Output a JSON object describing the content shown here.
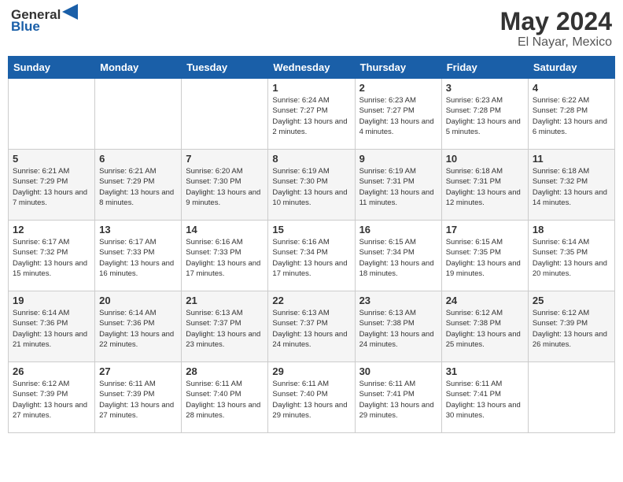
{
  "header": {
    "logo_general": "General",
    "logo_blue": "Blue",
    "title": "May 2024",
    "subtitle": "El Nayar, Mexico"
  },
  "days_of_week": [
    "Sunday",
    "Monday",
    "Tuesday",
    "Wednesday",
    "Thursday",
    "Friday",
    "Saturday"
  ],
  "weeks": [
    [
      {
        "day": "",
        "info": ""
      },
      {
        "day": "",
        "info": ""
      },
      {
        "day": "",
        "info": ""
      },
      {
        "day": "1",
        "info": "Sunrise: 6:24 AM\nSunset: 7:27 PM\nDaylight: 13 hours and 2 minutes."
      },
      {
        "day": "2",
        "info": "Sunrise: 6:23 AM\nSunset: 7:27 PM\nDaylight: 13 hours and 4 minutes."
      },
      {
        "day": "3",
        "info": "Sunrise: 6:23 AM\nSunset: 7:28 PM\nDaylight: 13 hours and 5 minutes."
      },
      {
        "day": "4",
        "info": "Sunrise: 6:22 AM\nSunset: 7:28 PM\nDaylight: 13 hours and 6 minutes."
      }
    ],
    [
      {
        "day": "5",
        "info": "Sunrise: 6:21 AM\nSunset: 7:29 PM\nDaylight: 13 hours and 7 minutes."
      },
      {
        "day": "6",
        "info": "Sunrise: 6:21 AM\nSunset: 7:29 PM\nDaylight: 13 hours and 8 minutes."
      },
      {
        "day": "7",
        "info": "Sunrise: 6:20 AM\nSunset: 7:30 PM\nDaylight: 13 hours and 9 minutes."
      },
      {
        "day": "8",
        "info": "Sunrise: 6:19 AM\nSunset: 7:30 PM\nDaylight: 13 hours and 10 minutes."
      },
      {
        "day": "9",
        "info": "Sunrise: 6:19 AM\nSunset: 7:31 PM\nDaylight: 13 hours and 11 minutes."
      },
      {
        "day": "10",
        "info": "Sunrise: 6:18 AM\nSunset: 7:31 PM\nDaylight: 13 hours and 12 minutes."
      },
      {
        "day": "11",
        "info": "Sunrise: 6:18 AM\nSunset: 7:32 PM\nDaylight: 13 hours and 14 minutes."
      }
    ],
    [
      {
        "day": "12",
        "info": "Sunrise: 6:17 AM\nSunset: 7:32 PM\nDaylight: 13 hours and 15 minutes."
      },
      {
        "day": "13",
        "info": "Sunrise: 6:17 AM\nSunset: 7:33 PM\nDaylight: 13 hours and 16 minutes."
      },
      {
        "day": "14",
        "info": "Sunrise: 6:16 AM\nSunset: 7:33 PM\nDaylight: 13 hours and 17 minutes."
      },
      {
        "day": "15",
        "info": "Sunrise: 6:16 AM\nSunset: 7:34 PM\nDaylight: 13 hours and 17 minutes."
      },
      {
        "day": "16",
        "info": "Sunrise: 6:15 AM\nSunset: 7:34 PM\nDaylight: 13 hours and 18 minutes."
      },
      {
        "day": "17",
        "info": "Sunrise: 6:15 AM\nSunset: 7:35 PM\nDaylight: 13 hours and 19 minutes."
      },
      {
        "day": "18",
        "info": "Sunrise: 6:14 AM\nSunset: 7:35 PM\nDaylight: 13 hours and 20 minutes."
      }
    ],
    [
      {
        "day": "19",
        "info": "Sunrise: 6:14 AM\nSunset: 7:36 PM\nDaylight: 13 hours and 21 minutes."
      },
      {
        "day": "20",
        "info": "Sunrise: 6:14 AM\nSunset: 7:36 PM\nDaylight: 13 hours and 22 minutes."
      },
      {
        "day": "21",
        "info": "Sunrise: 6:13 AM\nSunset: 7:37 PM\nDaylight: 13 hours and 23 minutes."
      },
      {
        "day": "22",
        "info": "Sunrise: 6:13 AM\nSunset: 7:37 PM\nDaylight: 13 hours and 24 minutes."
      },
      {
        "day": "23",
        "info": "Sunrise: 6:13 AM\nSunset: 7:38 PM\nDaylight: 13 hours and 24 minutes."
      },
      {
        "day": "24",
        "info": "Sunrise: 6:12 AM\nSunset: 7:38 PM\nDaylight: 13 hours and 25 minutes."
      },
      {
        "day": "25",
        "info": "Sunrise: 6:12 AM\nSunset: 7:39 PM\nDaylight: 13 hours and 26 minutes."
      }
    ],
    [
      {
        "day": "26",
        "info": "Sunrise: 6:12 AM\nSunset: 7:39 PM\nDaylight: 13 hours and 27 minutes."
      },
      {
        "day": "27",
        "info": "Sunrise: 6:11 AM\nSunset: 7:39 PM\nDaylight: 13 hours and 27 minutes."
      },
      {
        "day": "28",
        "info": "Sunrise: 6:11 AM\nSunset: 7:40 PM\nDaylight: 13 hours and 28 minutes."
      },
      {
        "day": "29",
        "info": "Sunrise: 6:11 AM\nSunset: 7:40 PM\nDaylight: 13 hours and 29 minutes."
      },
      {
        "day": "30",
        "info": "Sunrise: 6:11 AM\nSunset: 7:41 PM\nDaylight: 13 hours and 29 minutes."
      },
      {
        "day": "31",
        "info": "Sunrise: 6:11 AM\nSunset: 7:41 PM\nDaylight: 13 hours and 30 minutes."
      },
      {
        "day": "",
        "info": ""
      }
    ]
  ]
}
